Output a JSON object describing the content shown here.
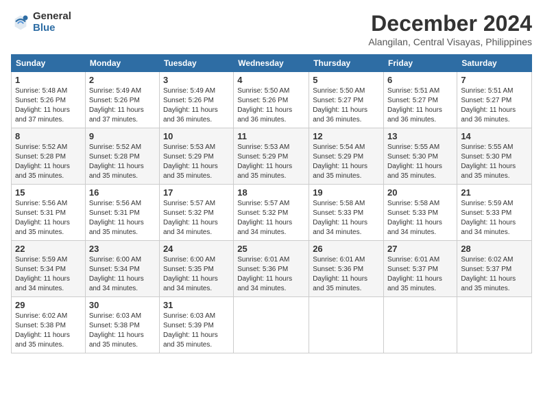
{
  "header": {
    "logo_general": "General",
    "logo_blue": "Blue",
    "month_title": "December 2024",
    "location": "Alangilan, Central Visayas, Philippines"
  },
  "weekdays": [
    "Sunday",
    "Monday",
    "Tuesday",
    "Wednesday",
    "Thursday",
    "Friday",
    "Saturday"
  ],
  "weeks": [
    [
      {
        "day": "1",
        "sunrise": "5:48 AM",
        "sunset": "5:26 PM",
        "daylight": "11 hours and 37 minutes."
      },
      {
        "day": "2",
        "sunrise": "5:49 AM",
        "sunset": "5:26 PM",
        "daylight": "11 hours and 37 minutes."
      },
      {
        "day": "3",
        "sunrise": "5:49 AM",
        "sunset": "5:26 PM",
        "daylight": "11 hours and 36 minutes."
      },
      {
        "day": "4",
        "sunrise": "5:50 AM",
        "sunset": "5:26 PM",
        "daylight": "11 hours and 36 minutes."
      },
      {
        "day": "5",
        "sunrise": "5:50 AM",
        "sunset": "5:27 PM",
        "daylight": "11 hours and 36 minutes."
      },
      {
        "day": "6",
        "sunrise": "5:51 AM",
        "sunset": "5:27 PM",
        "daylight": "11 hours and 36 minutes."
      },
      {
        "day": "7",
        "sunrise": "5:51 AM",
        "sunset": "5:27 PM",
        "daylight": "11 hours and 36 minutes."
      }
    ],
    [
      {
        "day": "8",
        "sunrise": "5:52 AM",
        "sunset": "5:28 PM",
        "daylight": "11 hours and 35 minutes."
      },
      {
        "day": "9",
        "sunrise": "5:52 AM",
        "sunset": "5:28 PM",
        "daylight": "11 hours and 35 minutes."
      },
      {
        "day": "10",
        "sunrise": "5:53 AM",
        "sunset": "5:29 PM",
        "daylight": "11 hours and 35 minutes."
      },
      {
        "day": "11",
        "sunrise": "5:53 AM",
        "sunset": "5:29 PM",
        "daylight": "11 hours and 35 minutes."
      },
      {
        "day": "12",
        "sunrise": "5:54 AM",
        "sunset": "5:29 PM",
        "daylight": "11 hours and 35 minutes."
      },
      {
        "day": "13",
        "sunrise": "5:55 AM",
        "sunset": "5:30 PM",
        "daylight": "11 hours and 35 minutes."
      },
      {
        "day": "14",
        "sunrise": "5:55 AM",
        "sunset": "5:30 PM",
        "daylight": "11 hours and 35 minutes."
      }
    ],
    [
      {
        "day": "15",
        "sunrise": "5:56 AM",
        "sunset": "5:31 PM",
        "daylight": "11 hours and 35 minutes."
      },
      {
        "day": "16",
        "sunrise": "5:56 AM",
        "sunset": "5:31 PM",
        "daylight": "11 hours and 35 minutes."
      },
      {
        "day": "17",
        "sunrise": "5:57 AM",
        "sunset": "5:32 PM",
        "daylight": "11 hours and 34 minutes."
      },
      {
        "day": "18",
        "sunrise": "5:57 AM",
        "sunset": "5:32 PM",
        "daylight": "11 hours and 34 minutes."
      },
      {
        "day": "19",
        "sunrise": "5:58 AM",
        "sunset": "5:33 PM",
        "daylight": "11 hours and 34 minutes."
      },
      {
        "day": "20",
        "sunrise": "5:58 AM",
        "sunset": "5:33 PM",
        "daylight": "11 hours and 34 minutes."
      },
      {
        "day": "21",
        "sunrise": "5:59 AM",
        "sunset": "5:33 PM",
        "daylight": "11 hours and 34 minutes."
      }
    ],
    [
      {
        "day": "22",
        "sunrise": "5:59 AM",
        "sunset": "5:34 PM",
        "daylight": "11 hours and 34 minutes."
      },
      {
        "day": "23",
        "sunrise": "6:00 AM",
        "sunset": "5:34 PM",
        "daylight": "11 hours and 34 minutes."
      },
      {
        "day": "24",
        "sunrise": "6:00 AM",
        "sunset": "5:35 PM",
        "daylight": "11 hours and 34 minutes."
      },
      {
        "day": "25",
        "sunrise": "6:01 AM",
        "sunset": "5:36 PM",
        "daylight": "11 hours and 34 minutes."
      },
      {
        "day": "26",
        "sunrise": "6:01 AM",
        "sunset": "5:36 PM",
        "daylight": "11 hours and 35 minutes."
      },
      {
        "day": "27",
        "sunrise": "6:01 AM",
        "sunset": "5:37 PM",
        "daylight": "11 hours and 35 minutes."
      },
      {
        "day": "28",
        "sunrise": "6:02 AM",
        "sunset": "5:37 PM",
        "daylight": "11 hours and 35 minutes."
      }
    ],
    [
      {
        "day": "29",
        "sunrise": "6:02 AM",
        "sunset": "5:38 PM",
        "daylight": "11 hours and 35 minutes."
      },
      {
        "day": "30",
        "sunrise": "6:03 AM",
        "sunset": "5:38 PM",
        "daylight": "11 hours and 35 minutes."
      },
      {
        "day": "31",
        "sunrise": "6:03 AM",
        "sunset": "5:39 PM",
        "daylight": "11 hours and 35 minutes."
      },
      null,
      null,
      null,
      null
    ]
  ],
  "labels": {
    "sunrise": "Sunrise:",
    "sunset": "Sunset:",
    "daylight": "Daylight:"
  }
}
